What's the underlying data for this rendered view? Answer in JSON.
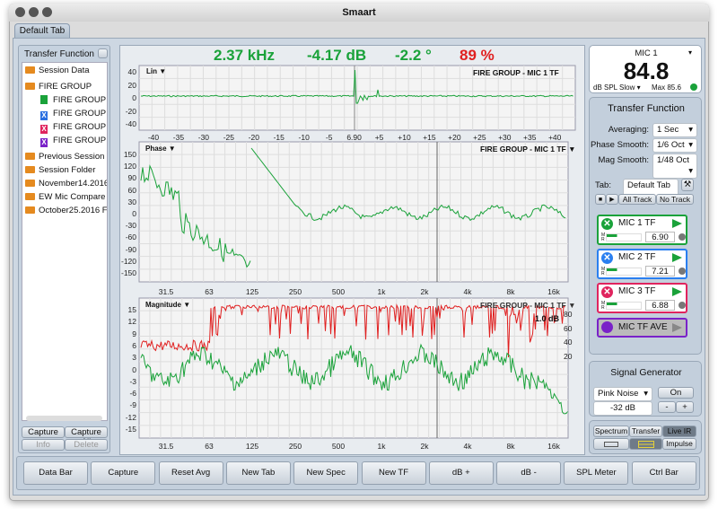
{
  "window": {
    "title": "Smaart",
    "tab": "Default Tab"
  },
  "left": {
    "title": "Transfer Function",
    "items": [
      {
        "label": "Session Data",
        "type": "folder"
      },
      {
        "label": "FIRE GROUP",
        "type": "folder"
      },
      {
        "label": "FIRE GROUP -",
        "type": "file",
        "color": "#1aa23a",
        "glyph": ""
      },
      {
        "label": "FIRE GROUP -",
        "type": "file",
        "color": "#2a6fe0",
        "glyph": "X"
      },
      {
        "label": "FIRE GROUP -",
        "type": "file",
        "color": "#e0245e",
        "glyph": "X"
      },
      {
        "label": "FIRE GROUP -",
        "type": "file",
        "color": "#7a22c8",
        "glyph": "X"
      },
      {
        "label": "Previous Session F",
        "type": "folder"
      },
      {
        "label": "Session Folder",
        "type": "folder"
      },
      {
        "label": "November14.2016",
        "type": "folder"
      },
      {
        "label": "EW Mic Compare",
        "type": "folder"
      },
      {
        "label": "October25.2016 F",
        "type": "folder"
      }
    ],
    "capture": "Capture",
    "capture_all": "Capture All",
    "info": "Info",
    "delete": "Delete"
  },
  "readouts": {
    "freq": "2.37 kHz",
    "mag": "-4.17 dB",
    "phase": "-2.2 °",
    "coherence": "89 %"
  },
  "lin": {
    "label": "Lin",
    "title": "FIRE GROUP - MIC 1 TF",
    "yticks": [
      "40",
      "20",
      "0",
      "-20",
      "-40"
    ],
    "xticks": [
      "-40",
      "-35",
      "-30",
      "-25",
      "-20",
      "-15",
      "-10",
      "-5",
      "6.90",
      "+5",
      "+10",
      "+15",
      "+20",
      "+25",
      "+30",
      "+35",
      "+40"
    ]
  },
  "phase": {
    "label": "Phase",
    "title": "FIRE GROUP - MIC 1 TF",
    "yticks": [
      "150",
      "120",
      "90",
      "60",
      "30",
      "0",
      "-30",
      "-60",
      "-90",
      "-120",
      "-150"
    ]
  },
  "magnitude": {
    "label": "Magnitude",
    "title": "FIRE GROUP - MIC 1 TF",
    "scale": "1.0 dB",
    "yticks": [
      "15",
      "12",
      "9",
      "6",
      "3",
      "0",
      "-3",
      "-6",
      "-9",
      "-12",
      "-15"
    ],
    "yticks_right": [
      "80",
      "60",
      "40",
      "20"
    ]
  },
  "freq_ticks": [
    "31.5",
    "63",
    "125",
    "250",
    "500",
    "1k",
    "2k",
    "4k",
    "8k",
    "16k"
  ],
  "spl": {
    "mic": "MIC 1",
    "value": "84.8",
    "mode": "dB SPL Slow",
    "max_label": "Max",
    "max": "85.6"
  },
  "tf": {
    "title": "Transfer Function",
    "averaging_label": "Averaging:",
    "averaging": "1 Sec",
    "phase_smooth_label": "Phase Smooth:",
    "phase_smooth": "1/6 Oct",
    "mag_smooth_label": "Mag Smooth:",
    "mag_smooth": "1/48 Oct",
    "tab_label": "Tab:",
    "tab": "Default Tab",
    "all_track": "All Track",
    "no_track": "No Track",
    "mics": [
      {
        "name": "MIC 1 TF",
        "delay": "6.90",
        "color": "#1aa23a"
      },
      {
        "name": "MIC 2 TF",
        "delay": "7.21",
        "color": "#2a7ff0"
      },
      {
        "name": "MIC 3 TF",
        "delay": "6.88",
        "color": "#e0245e"
      }
    ],
    "ave": {
      "name": "MIC TF AVE",
      "color": "#7a22c8"
    }
  },
  "siggen": {
    "title": "Signal Generator",
    "signal": "Pink Noise",
    "on": "On",
    "level": "-32 dB",
    "minus": "-",
    "plus": "+"
  },
  "modes": {
    "spectrum": "Spectrum",
    "transfer": "Transfer",
    "live_ir": "Live IR",
    "impulse": "Impulse"
  },
  "bottom": [
    "Data Bar",
    "Capture",
    "Reset Avg",
    "New Tab",
    "New Spec",
    "New TF",
    "dB +",
    "dB -",
    "SPL Meter",
    "Ctrl Bar"
  ]
}
